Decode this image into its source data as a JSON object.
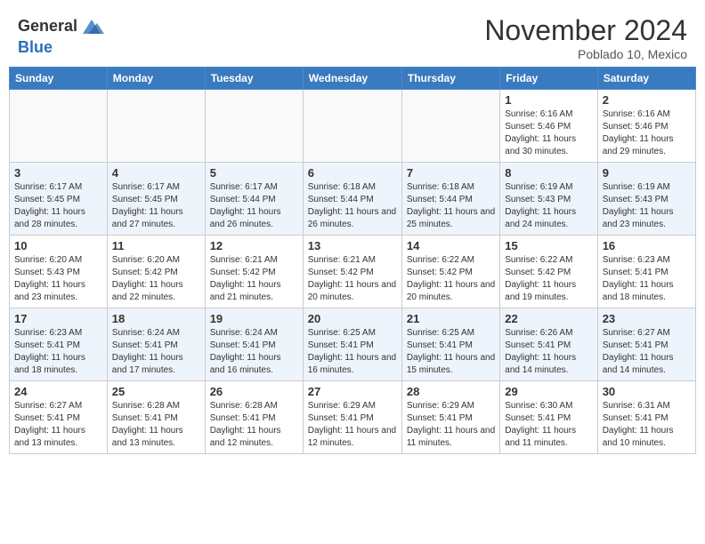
{
  "header": {
    "logo_general": "General",
    "logo_blue": "Blue",
    "month": "November 2024",
    "location": "Poblado 10, Mexico"
  },
  "days_of_week": [
    "Sunday",
    "Monday",
    "Tuesday",
    "Wednesday",
    "Thursday",
    "Friday",
    "Saturday"
  ],
  "weeks": [
    [
      {
        "day": "",
        "empty": true
      },
      {
        "day": "",
        "empty": true
      },
      {
        "day": "",
        "empty": true
      },
      {
        "day": "",
        "empty": true
      },
      {
        "day": "",
        "empty": true
      },
      {
        "day": "1",
        "sunrise": "Sunrise: 6:16 AM",
        "sunset": "Sunset: 5:46 PM",
        "daylight": "Daylight: 11 hours and 30 minutes."
      },
      {
        "day": "2",
        "sunrise": "Sunrise: 6:16 AM",
        "sunset": "Sunset: 5:46 PM",
        "daylight": "Daylight: 11 hours and 29 minutes."
      }
    ],
    [
      {
        "day": "3",
        "sunrise": "Sunrise: 6:17 AM",
        "sunset": "Sunset: 5:45 PM",
        "daylight": "Daylight: 11 hours and 28 minutes."
      },
      {
        "day": "4",
        "sunrise": "Sunrise: 6:17 AM",
        "sunset": "Sunset: 5:45 PM",
        "daylight": "Daylight: 11 hours and 27 minutes."
      },
      {
        "day": "5",
        "sunrise": "Sunrise: 6:17 AM",
        "sunset": "Sunset: 5:44 PM",
        "daylight": "Daylight: 11 hours and 26 minutes."
      },
      {
        "day": "6",
        "sunrise": "Sunrise: 6:18 AM",
        "sunset": "Sunset: 5:44 PM",
        "daylight": "Daylight: 11 hours and 26 minutes."
      },
      {
        "day": "7",
        "sunrise": "Sunrise: 6:18 AM",
        "sunset": "Sunset: 5:44 PM",
        "daylight": "Daylight: 11 hours and 25 minutes."
      },
      {
        "day": "8",
        "sunrise": "Sunrise: 6:19 AM",
        "sunset": "Sunset: 5:43 PM",
        "daylight": "Daylight: 11 hours and 24 minutes."
      },
      {
        "day": "9",
        "sunrise": "Sunrise: 6:19 AM",
        "sunset": "Sunset: 5:43 PM",
        "daylight": "Daylight: 11 hours and 23 minutes."
      }
    ],
    [
      {
        "day": "10",
        "sunrise": "Sunrise: 6:20 AM",
        "sunset": "Sunset: 5:43 PM",
        "daylight": "Daylight: 11 hours and 23 minutes."
      },
      {
        "day": "11",
        "sunrise": "Sunrise: 6:20 AM",
        "sunset": "Sunset: 5:42 PM",
        "daylight": "Daylight: 11 hours and 22 minutes."
      },
      {
        "day": "12",
        "sunrise": "Sunrise: 6:21 AM",
        "sunset": "Sunset: 5:42 PM",
        "daylight": "Daylight: 11 hours and 21 minutes."
      },
      {
        "day": "13",
        "sunrise": "Sunrise: 6:21 AM",
        "sunset": "Sunset: 5:42 PM",
        "daylight": "Daylight: 11 hours and 20 minutes."
      },
      {
        "day": "14",
        "sunrise": "Sunrise: 6:22 AM",
        "sunset": "Sunset: 5:42 PM",
        "daylight": "Daylight: 11 hours and 20 minutes."
      },
      {
        "day": "15",
        "sunrise": "Sunrise: 6:22 AM",
        "sunset": "Sunset: 5:42 PM",
        "daylight": "Daylight: 11 hours and 19 minutes."
      },
      {
        "day": "16",
        "sunrise": "Sunrise: 6:23 AM",
        "sunset": "Sunset: 5:41 PM",
        "daylight": "Daylight: 11 hours and 18 minutes."
      }
    ],
    [
      {
        "day": "17",
        "sunrise": "Sunrise: 6:23 AM",
        "sunset": "Sunset: 5:41 PM",
        "daylight": "Daylight: 11 hours and 18 minutes."
      },
      {
        "day": "18",
        "sunrise": "Sunrise: 6:24 AM",
        "sunset": "Sunset: 5:41 PM",
        "daylight": "Daylight: 11 hours and 17 minutes."
      },
      {
        "day": "19",
        "sunrise": "Sunrise: 6:24 AM",
        "sunset": "Sunset: 5:41 PM",
        "daylight": "Daylight: 11 hours and 16 minutes."
      },
      {
        "day": "20",
        "sunrise": "Sunrise: 6:25 AM",
        "sunset": "Sunset: 5:41 PM",
        "daylight": "Daylight: 11 hours and 16 minutes."
      },
      {
        "day": "21",
        "sunrise": "Sunrise: 6:25 AM",
        "sunset": "Sunset: 5:41 PM",
        "daylight": "Daylight: 11 hours and 15 minutes."
      },
      {
        "day": "22",
        "sunrise": "Sunrise: 6:26 AM",
        "sunset": "Sunset: 5:41 PM",
        "daylight": "Daylight: 11 hours and 14 minutes."
      },
      {
        "day": "23",
        "sunrise": "Sunrise: 6:27 AM",
        "sunset": "Sunset: 5:41 PM",
        "daylight": "Daylight: 11 hours and 14 minutes."
      }
    ],
    [
      {
        "day": "24",
        "sunrise": "Sunrise: 6:27 AM",
        "sunset": "Sunset: 5:41 PM",
        "daylight": "Daylight: 11 hours and 13 minutes."
      },
      {
        "day": "25",
        "sunrise": "Sunrise: 6:28 AM",
        "sunset": "Sunset: 5:41 PM",
        "daylight": "Daylight: 11 hours and 13 minutes."
      },
      {
        "day": "26",
        "sunrise": "Sunrise: 6:28 AM",
        "sunset": "Sunset: 5:41 PM",
        "daylight": "Daylight: 11 hours and 12 minutes."
      },
      {
        "day": "27",
        "sunrise": "Sunrise: 6:29 AM",
        "sunset": "Sunset: 5:41 PM",
        "daylight": "Daylight: 11 hours and 12 minutes."
      },
      {
        "day": "28",
        "sunrise": "Sunrise: 6:29 AM",
        "sunset": "Sunset: 5:41 PM",
        "daylight": "Daylight: 11 hours and 11 minutes."
      },
      {
        "day": "29",
        "sunrise": "Sunrise: 6:30 AM",
        "sunset": "Sunset: 5:41 PM",
        "daylight": "Daylight: 11 hours and 11 minutes."
      },
      {
        "day": "30",
        "sunrise": "Sunrise: 6:31 AM",
        "sunset": "Sunset: 5:41 PM",
        "daylight": "Daylight: 11 hours and 10 minutes."
      }
    ]
  ]
}
